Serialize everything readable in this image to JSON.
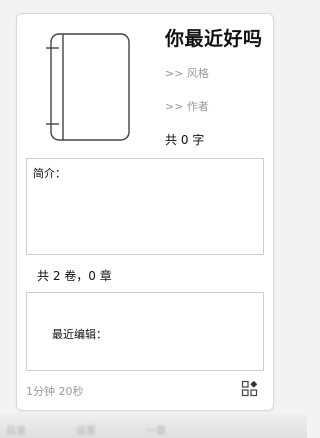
{
  "card": {
    "title": "你最近好吗",
    "style_link": ">> 风格",
    "author_link": ">> 作者",
    "word_count": "共 0 字",
    "intro_label": "简介：",
    "volumes_chapters": "共 2 卷，0 章",
    "recent_edit_label": "最近编辑：",
    "elapsed_time": "1分钟 20秒",
    "cover_icon": "book-icon",
    "action_icon": "grid-icon"
  },
  "bottom_tabs": [
    {
      "label": "目录"
    },
    {
      "label": "设置"
    },
    {
      "label": "一章"
    }
  ],
  "colors": {
    "muted_text": "#9a9a9a",
    "border": "#cfcfcf",
    "background": "#f3f3f3"
  }
}
